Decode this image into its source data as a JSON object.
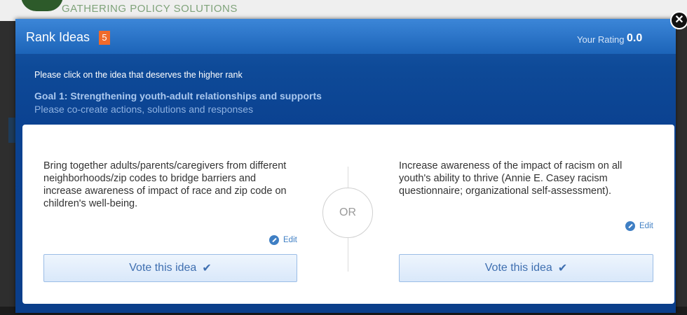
{
  "backdrop": {
    "site_name": "GATHERING POLICY SOLUTIONS"
  },
  "modal": {
    "title": "Rank Ideas",
    "count": "5",
    "rating_label": "Your Rating",
    "rating_value": "0.0",
    "instruction": "Please click on the idea that deserves the higher rank",
    "goal_title": "Goal 1: Strengthening youth-adult relationships and supports",
    "goal_subtitle": "Please co-create actions, solutions and responses",
    "close_symbol": "✕"
  },
  "compare": {
    "or_label": "OR",
    "ideas": [
      {
        "text": "Bring together adults/parents/caregivers from different neighborhoods/zip codes to bridge barriers and increase awareness of impact of race and zip code on children's well-being.",
        "edit_label": "Edit",
        "vote_label": "Vote this idea",
        "vote_icon": "check-icon"
      },
      {
        "text": "Increase awareness of the impact of racism on all youth's ability to thrive (Annie E. Casey racism questionnaire; organizational self-assessment).",
        "edit_label": "Edit",
        "vote_label": "Vote this idea",
        "vote_icon": "check-icon"
      }
    ]
  },
  "colors": {
    "header_blue": "#1c64b8",
    "badge_orange": "#f06a2a",
    "link_blue": "#3f7fc4"
  }
}
